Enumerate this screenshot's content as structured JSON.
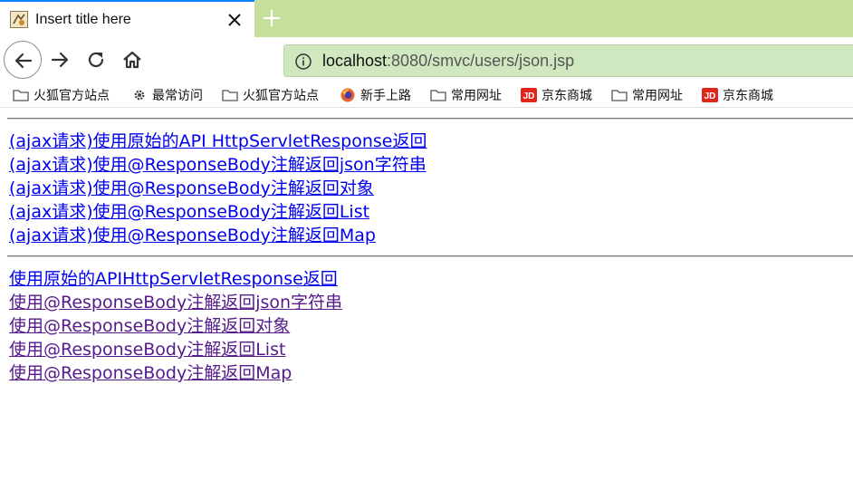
{
  "tab": {
    "title": "Insert title here",
    "favicon": "eclipse-jsp-icon",
    "close": "close-icon",
    "new_tab": "plus-icon"
  },
  "nav": {
    "back": "back-arrow-icon",
    "forward": "forward-arrow-icon",
    "reload": "reload-icon",
    "home": "home-icon",
    "url_info": "info-icon",
    "url_host": "localhost",
    "url_rest": ":8080/smvc/users/json.jsp"
  },
  "bookmarks": [
    {
      "label": "火狐官方站点",
      "icon": "folder-icon"
    },
    {
      "label": "最常访问",
      "icon": "gear-icon"
    },
    {
      "label": "火狐官方站点",
      "icon": "folder-icon"
    },
    {
      "label": "新手上路",
      "icon": "firefox-icon"
    },
    {
      "label": "常用网址",
      "icon": "folder-icon"
    },
    {
      "label": "京东商城",
      "icon": "jd-icon"
    },
    {
      "label": "常用网址",
      "icon": "folder-icon"
    },
    {
      "label": "京东商城",
      "icon": "jd-icon"
    }
  ],
  "colors": {
    "tab_accent": "#0a84ff",
    "tabstrip_bg": "#c5df9c",
    "urlbar_bg": "#cfe8c0",
    "link_unvisited": "#0000ee",
    "link_visited": "#551a8b",
    "jd_red": "#e1251b"
  },
  "ajax_links": [
    "(ajax请求)使用原始的API HttpServletResponse返回",
    "(ajax请求)使用@ResponseBody注解返回json字符串",
    "(ajax请求)使用@ResponseBody注解返回对象",
    "(ajax请求)使用@ResponseBody注解返回List",
    "(ajax请求)使用@ResponseBody注解返回Map"
  ],
  "links": [
    "使用原始的APIHttpServletResponse返回",
    "使用@ResponseBody注解返回json字符串",
    "使用@ResponseBody注解返回对象",
    "使用@ResponseBody注解返回List",
    "使用@ResponseBody注解返回Map"
  ]
}
